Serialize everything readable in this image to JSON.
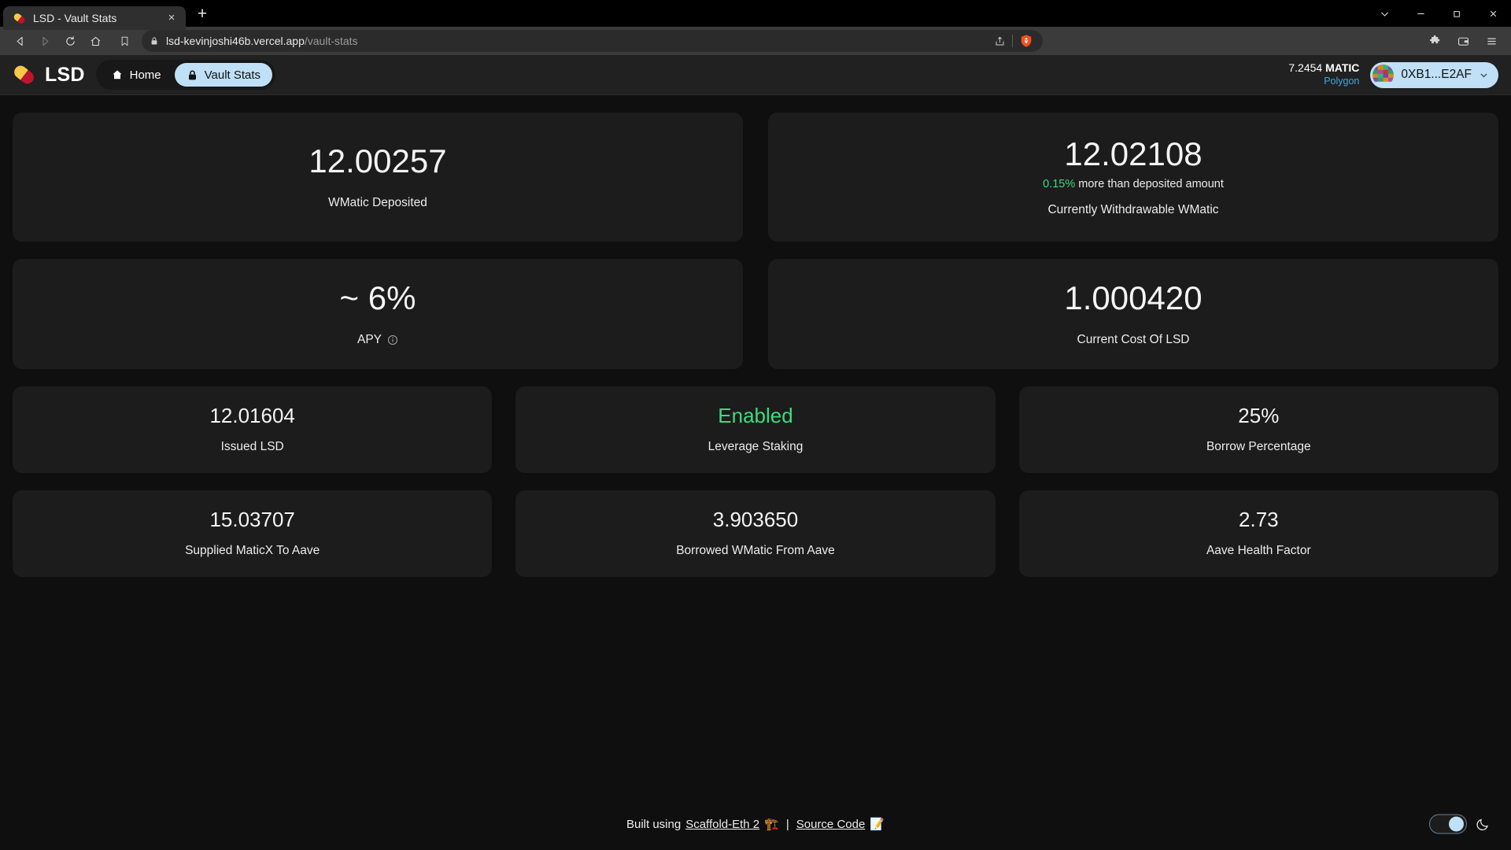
{
  "browser": {
    "tab": {
      "title": "LSD - Vault Stats",
      "favicon": "pill-icon",
      "close": "×"
    },
    "new_tab": "+",
    "window_controls": [
      "tab-search-chevron-icon",
      "minimize-icon",
      "restore-icon",
      "close-icon"
    ],
    "nav": {
      "back": "back-icon",
      "forward": "forward-icon",
      "reload": "reload-icon",
      "home": "home-icon"
    },
    "omnibox": {
      "bookmark": "bookmark-icon",
      "lock": "lock-icon",
      "url_host": "lsd-kevinjoshi46b.vercel.app",
      "url_path": "/vault-stats",
      "share": "share-icon",
      "shields": "brave-shields-icon"
    },
    "toolbar_right": [
      "extensions-puzzle-icon",
      "wallet-icon",
      "menu-icon"
    ]
  },
  "app": {
    "brand": {
      "logo": "lsd-pill-logo",
      "name": "LSD"
    },
    "nav": [
      {
        "label": "Home",
        "icon": "home-icon",
        "active": false
      },
      {
        "label": "Vault Stats",
        "icon": "lock-icon",
        "active": true
      }
    ],
    "wallet": {
      "balance": "7.2454",
      "balance_symbol": "MATIC",
      "network": "Polygon",
      "address": "0XB1...E2AF",
      "avatar": "blockie-avatar",
      "chevron": "chevron-down-icon"
    }
  },
  "stats": {
    "row1": [
      {
        "value": "12.00257",
        "label": "WMatic Deposited"
      },
      {
        "value": "12.02108",
        "sub_pct": "0.15%",
        "sub_text": " more than deposited amount",
        "label": "Currently Withdrawable WMatic"
      }
    ],
    "row2": [
      {
        "value": "~ 6%",
        "label": "APY",
        "info_icon": "info-icon"
      },
      {
        "value": "1.000420",
        "label": "Current Cost Of LSD"
      }
    ],
    "row3": [
      {
        "value": "12.01604",
        "label": "Issued LSD"
      },
      {
        "value": "Enabled",
        "label": "Leverage Staking",
        "state": "green"
      },
      {
        "value": "25%",
        "label": "Borrow Percentage"
      }
    ],
    "row4": [
      {
        "value": "15.03707",
        "label": "Supplied MaticX To Aave"
      },
      {
        "value": "3.903650",
        "label": "Borrowed WMatic From Aave"
      },
      {
        "value": "2.73",
        "label": "Aave Health Factor"
      }
    ]
  },
  "footer": {
    "built_using": "Built using",
    "scaffold_link": "Scaffold-Eth 2",
    "scaffold_emoji": "🏗️",
    "separator": "|",
    "source_link": "Source Code",
    "source_emoji": "📝",
    "theme_toggle": "theme-toggle",
    "moon_icon": "moon-icon"
  },
  "colors": {
    "accent_blue": "#bfe0f7",
    "green": "#3ddc7f",
    "network_blue": "#3fa8e0",
    "card_bg": "#1c1c1c",
    "page_bg": "#0f0f0f"
  }
}
